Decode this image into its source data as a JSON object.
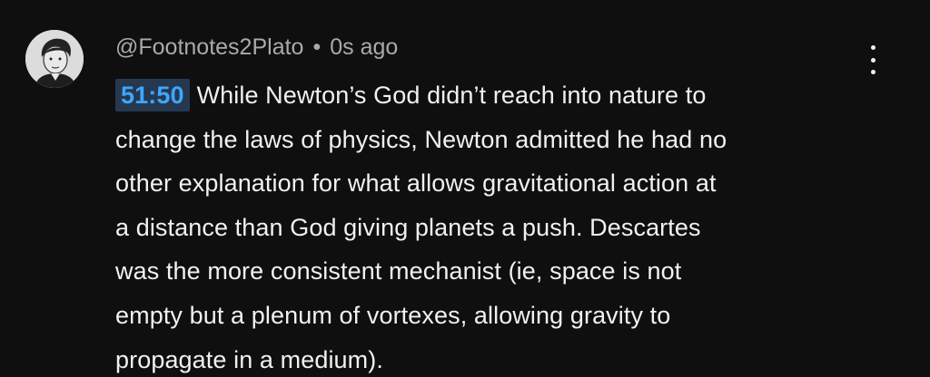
{
  "comment": {
    "author": "@Footnotes2Plato",
    "separator": "•",
    "time_ago": "0s ago",
    "timestamp_link": "51:50",
    "lines": [
      "While Newton’s God didn’t reach into nature to",
      "change the laws of physics, Newton admitted he had no",
      "other explanation for what allows gravitational action at",
      "a distance than God giving planets a push. Descartes",
      "was the more consistent mechanist (ie, space is not",
      "empty but a plenum of vortexes, allowing gravity to",
      "propagate in a medium)."
    ],
    "avatar_icon": "person-avatar-icon",
    "menu_icon": "vertical-ellipsis-icon"
  },
  "colors": {
    "background": "#0f0f0f",
    "text": "#f1f1f1",
    "meta": "#aaaaaa",
    "timestamp_text": "#3ea6ff",
    "timestamp_bg": "#263850"
  }
}
